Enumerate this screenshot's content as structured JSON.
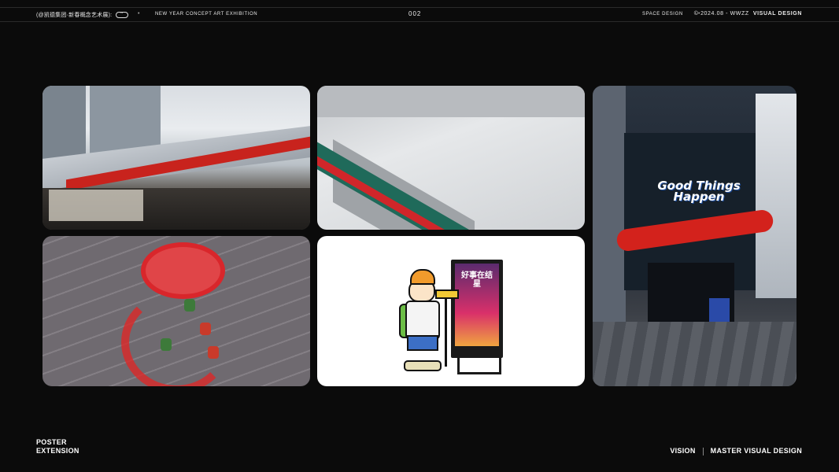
{
  "header": {
    "left_text": "(@凯德集团·新春概念艺术展):",
    "center_text": "NEW YEAR CONCEPT ART EXHIBITION",
    "page_number": "002",
    "right_label": "SPACE DESIGN",
    "copyright": "© 2024.08 - Wwzz",
    "brand": "VISUAL DESIGN",
    "bullet": "•"
  },
  "panels": {
    "p3_text_line1": "Good Things",
    "p3_text_line2": "Happen",
    "p5_poster_text": "好事在结星"
  },
  "footer": {
    "left_line1": "POSTER",
    "left_line2": "EXTENSION",
    "right_vision": "VISION",
    "right_master": "MASTER VISUAL DESIGN"
  },
  "colors": {
    "background": "#0b0b0b",
    "accent_red": "#d3221c",
    "text": "#ffffff"
  }
}
